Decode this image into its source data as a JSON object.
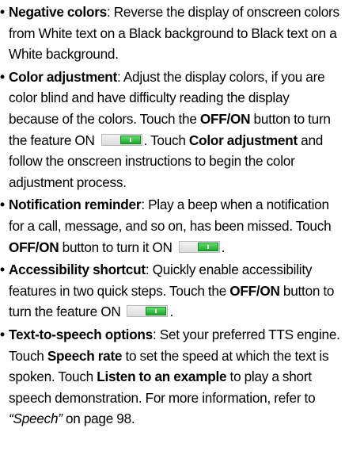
{
  "bullet_symbol": "•",
  "items": [
    {
      "term": "Negative colors",
      "sep": ": ",
      "t1": "Reverse the display of onscreen colors from White text on a Black background to Black text on a White background."
    },
    {
      "term": "Color adjustment",
      "sep": ": ",
      "t1": "Adjust the display colors, if you are color blind and have difficulty reading the display because of the colors. Touch the ",
      "b1": "OFF/ON",
      "t2": " button to turn the feature ON",
      "t3": ". Touch ",
      "b2": "Color adjustment",
      "t4": " and follow the onscreen instructions to begin the color adjustment process."
    },
    {
      "term": "Notification reminder",
      "sep": ": ",
      "t1": "Play a beep when a notification for a call, message, and so on, has been missed. Touch ",
      "b1": "OFF/ON",
      "t2": " button to turn it ON",
      "t3": "."
    },
    {
      "term": "Accessibility shortcut",
      "sep": ": ",
      "t1": "Quickly enable accessibility features in two quick steps. Touch the ",
      "b1": "OFF/ON",
      "t2": " button to turn the feature ON",
      "t3": "."
    },
    {
      "term": "Text-to-speech options",
      "sep": ": ",
      "t1": "Set your preferred TTS engine. Touch ",
      "b1": "Speech rate",
      "t2": " to set the speed at which the text is spoken. Touch ",
      "b2": "Listen to an example",
      "t3": " to play a short speech demonstration. For more information, refer to ",
      "ref": "“Speech”",
      "t4": " on page 98."
    }
  ],
  "toggle": {
    "state": "on",
    "knob_color": "#2dbd3a",
    "track_color": "#e6e6e6"
  }
}
